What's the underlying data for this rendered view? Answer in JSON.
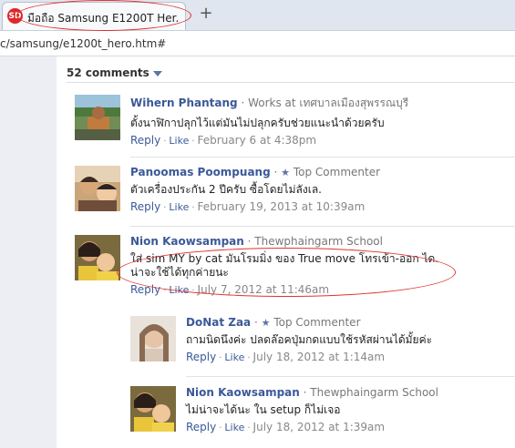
{
  "browser": {
    "tab_favicon": "SD",
    "tab_title": "มือถือ Samsung E1200T Her...",
    "new_tab": "+",
    "url": "c/samsung/e1200t_hero.htm#"
  },
  "comments_header": "52 comments",
  "labels": {
    "reply": "Reply",
    "like": "Like",
    "dot": "·",
    "star": "★"
  },
  "comments": [
    {
      "name": "Wihern Phantang",
      "meta": "· Works at เทศบาลเมืองสุพรรณบุรี",
      "text": [
        "ตั้งนาฬิกาปลุกไว้แต่มันไม่ปลุกครับช่วยแนะนำด้วยครับ"
      ],
      "date": "February 6 at 4:38pm"
    },
    {
      "name": "Panoomas Poompuang",
      "meta": "Top Commenter",
      "text": [
        "ตัวเครื่องประกัน 2 ปีครับ ซื้อโดยไม่ลังเล."
      ],
      "date": "February 19, 2013 at 10:39am"
    },
    {
      "name": "Nion Kaowsampan",
      "meta": "· Thewphaingarm School",
      "text": [
        "ใส่ sim MY by cat มันโรมมิ่ง ของ True move โทรเข้า-ออก ได.",
        "น่าจะใช้ได้ทุกค่ายนะ"
      ],
      "date": "July 7, 2012 at 11:46am"
    },
    {
      "name": "DoNat Zaa",
      "meta": "Top Commenter",
      "text": [
        "ถามนิดนึงค่ะ ปลดล๊อคปุ่มกดแบบใช้รหัสผ่านได้มั้ยค่ะ"
      ],
      "date": "July 18, 2012 at 1:14am"
    },
    {
      "name": "Nion Kaowsampan",
      "meta": "· Thewphaingarm School",
      "text": [
        "ไม่น่าจะได้นะ ใน setup ก็ไม่เจอ"
      ],
      "date": "July 18, 2012 at 1:39am"
    }
  ]
}
